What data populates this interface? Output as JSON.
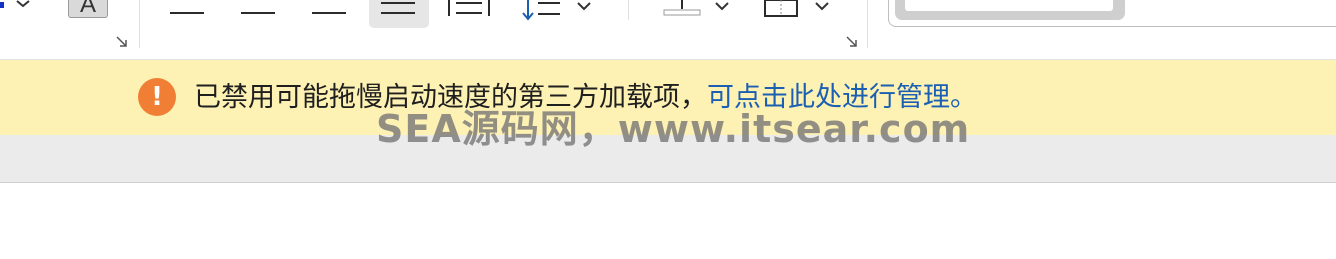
{
  "ribbon": {
    "font_color_glyph": "A",
    "icons": [
      "align-left-icon",
      "align-center-icon",
      "align-right-icon",
      "justify-icon",
      "distributed-icon",
      "line-spacing-icon",
      "shading-icon",
      "borders-icon",
      "dialog-launcher-icon",
      "chevron-down-icon"
    ]
  },
  "notification": {
    "icon_glyph": "!",
    "message": "已禁用可能拖慢启动速度的第三方加载项，",
    "link_text": "可点击此处进行管理。",
    "bar_color": "#fdf1b4",
    "icon_color": "#f07f35",
    "link_color": "#1b5fb3"
  },
  "watermark": {
    "text": "SEA源码网，www.itsear.com"
  }
}
